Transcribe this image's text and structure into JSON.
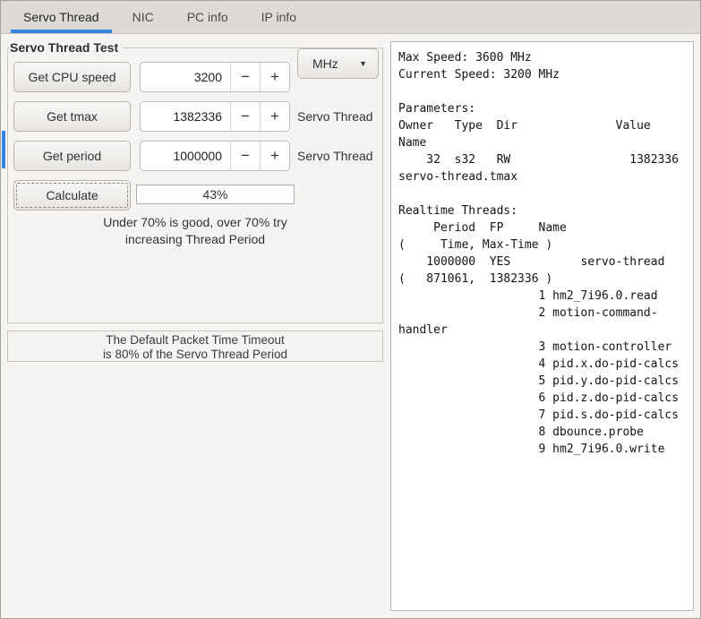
{
  "window": {
    "bg": "#f5f4f2",
    "accent": "#3584e4"
  },
  "tabs": [
    {
      "label": "Servo Thread",
      "active": true
    },
    {
      "label": "NIC",
      "active": false
    },
    {
      "label": "PC info",
      "active": false
    },
    {
      "label": "IP info",
      "active": false
    }
  ],
  "frame": {
    "title": "Servo Thread Test"
  },
  "rows": [
    {
      "button": "Get CPU speed",
      "value": "3200",
      "suffix": "MHz",
      "suffix_type": "combo"
    },
    {
      "button": "Get tmax",
      "value": "1382336",
      "suffix": "Servo Thread",
      "suffix_type": "label"
    },
    {
      "button": "Get period",
      "value": "1000000",
      "suffix": "Servo Thread",
      "suffix_type": "label"
    }
  ],
  "calculate": {
    "button": "Calculate",
    "result": "43%"
  },
  "hint": {
    "line1": "Under 70% is good, over 70% try",
    "line2": "increasing Thread Period"
  },
  "timeout_note": {
    "line1": "The Default Packet Time Timeout",
    "line2": "is 80% of the Servo Thread Period"
  },
  "icons": {
    "minus": "−",
    "plus": "+",
    "dropdown": "▼"
  },
  "console": {
    "lines": [
      "Max Speed: 3600 MHz",
      "Current Speed: 3200 MHz",
      "",
      "Parameters:",
      "Owner   Type  Dir              Value",
      "Name",
      "    32  s32   RW                 1382336",
      "servo-thread.tmax",
      "",
      "Realtime Threads:",
      "     Period  FP     Name",
      "(     Time, Max-Time )",
      "    1000000  YES          servo-thread",
      "(   871061,  1382336 )",
      "                    1 hm2_7i96.0.read",
      "                    2 motion-command-",
      "handler",
      "                    3 motion-controller",
      "                    4 pid.x.do-pid-calcs",
      "                    5 pid.y.do-pid-calcs",
      "                    6 pid.z.do-pid-calcs",
      "                    7 pid.s.do-pid-calcs",
      "                    8 dbounce.probe",
      "                    9 hm2_7i96.0.write"
    ]
  }
}
